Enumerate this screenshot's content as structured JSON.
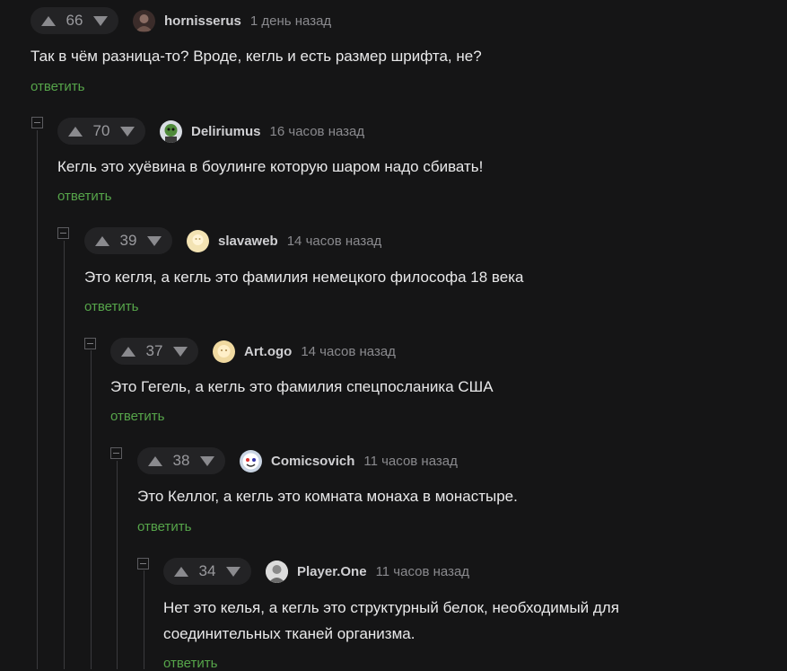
{
  "comments": [
    {
      "score": "66",
      "author": "hornisserus",
      "time": "1 день назад",
      "text": "Так в чём разница-то? Вроде, кегль и есть размер шрифта, не?",
      "reply": "ответить",
      "avatar_color": "#3b2c2a",
      "avatar_icon": "user-avatar-icon"
    },
    {
      "score": "70",
      "author": "Deliriumus",
      "time": "16 часов назад",
      "text": "Кегль это хуёвина в боулинге которую шаром надо сбивать!",
      "reply": "ответить",
      "avatar_color": "#4e8a3a",
      "avatar_icon": "zombie-avatar-icon"
    },
    {
      "score": "39",
      "author": "slavaweb",
      "time": "14 часов назад",
      "text": "Это кегля, а кегль это фамилия немецкого философа 18 века",
      "reply": "ответить",
      "avatar_color": "#f3e3b3",
      "avatar_icon": "user-avatar-icon"
    },
    {
      "score": "37",
      "author": "Art.ogo",
      "time": "14 часов назад",
      "text": "Это Гегель, а кегль это фамилия спецпосланика США",
      "reply": "ответить",
      "avatar_color": "#f0d9a0",
      "avatar_icon": "user-avatar-icon"
    },
    {
      "score": "38",
      "author": "Comicsovich",
      "time": "11 часов назад",
      "text": "Это Келлог, а кегль это комната монаха в монастыре.",
      "reply": "ответить",
      "avatar_color": "#c9d4e3",
      "avatar_icon": "user-avatar-icon"
    },
    {
      "score": "34",
      "author": "Player.One",
      "time": "11 часов назад",
      "text_line1": "Нет это келья, а кегль это структурный белок, необходимый для",
      "text_line2": "соединительных тканей организма.",
      "reply": "ответить",
      "avatar_color": "#9a9a9a",
      "avatar_icon": "user-avatar-icon"
    }
  ]
}
